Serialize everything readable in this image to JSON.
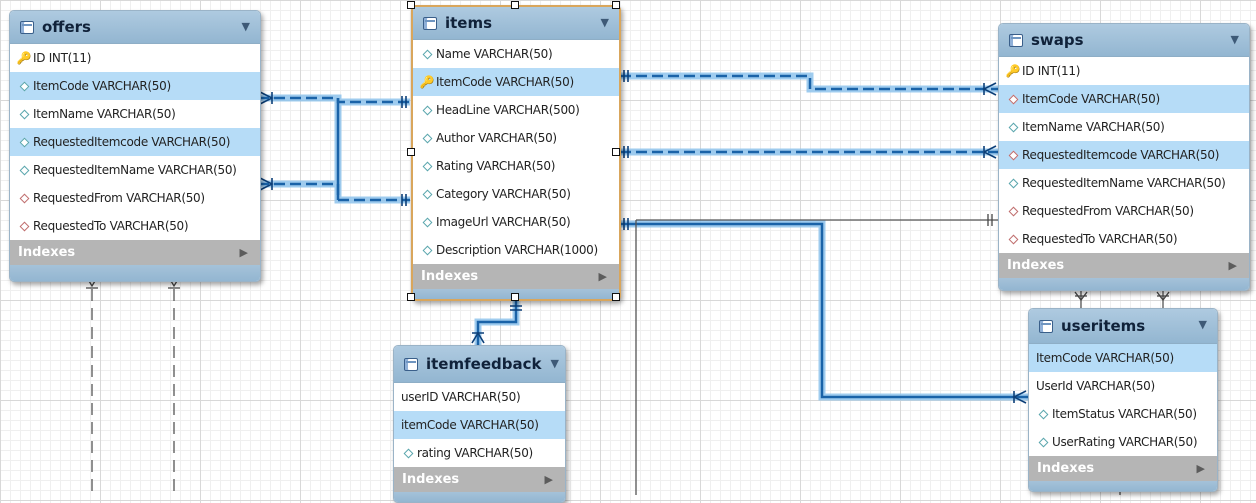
{
  "tables": {
    "offers": {
      "name": "offers",
      "fields": [
        {
          "label": "ID INT(11)",
          "icon": "key-icon"
        },
        {
          "label": "ItemCode VARCHAR(50)",
          "icon": "diamond-icon"
        },
        {
          "label": "ItemName VARCHAR(50)",
          "icon": "diamond-icon"
        },
        {
          "label": "RequestedItemcode VARCHAR(50)",
          "icon": "diamond-icon"
        },
        {
          "label": "RequestedItemName VARCHAR(50)",
          "icon": "diamond-icon"
        },
        {
          "label": "RequestedFrom VARCHAR(50)",
          "icon": "red-diamond-icon"
        },
        {
          "label": "RequestedTo VARCHAR(50)",
          "icon": "red-diamond-icon"
        }
      ],
      "indexes_label": "Indexes"
    },
    "items": {
      "name": "items",
      "fields": [
        {
          "label": "Name VARCHAR(50)",
          "icon": "diamond-icon"
        },
        {
          "label": "ItemCode VARCHAR(50)",
          "icon": "key-icon"
        },
        {
          "label": "HeadLine VARCHAR(500)",
          "icon": "diamond-icon"
        },
        {
          "label": "Author VARCHAR(50)",
          "icon": "diamond-icon"
        },
        {
          "label": "Rating VARCHAR(50)",
          "icon": "diamond-icon"
        },
        {
          "label": "Category VARCHAR(50)",
          "icon": "diamond-icon"
        },
        {
          "label": "ImageUrl VARCHAR(50)",
          "icon": "diamond-icon"
        },
        {
          "label": "Description VARCHAR(1000)",
          "icon": "diamond-icon"
        }
      ],
      "indexes_label": "Indexes"
    },
    "swaps": {
      "name": "swaps",
      "fields": [
        {
          "label": "ID INT(11)",
          "icon": "key-icon"
        },
        {
          "label": "ItemCode VARCHAR(50)",
          "icon": "red-diamond-icon"
        },
        {
          "label": "ItemName VARCHAR(50)",
          "icon": "diamond-icon"
        },
        {
          "label": "RequestedItemcode VARCHAR(50)",
          "icon": "red-diamond-icon"
        },
        {
          "label": "RequestedItemName VARCHAR(50)",
          "icon": "diamond-icon"
        },
        {
          "label": "RequestedFrom VARCHAR(50)",
          "icon": "red-diamond-icon"
        },
        {
          "label": "RequestedTo VARCHAR(50)",
          "icon": "red-diamond-icon"
        }
      ],
      "indexes_label": "Indexes"
    },
    "itemfeedback": {
      "name": "itemfeedback",
      "fields": [
        {
          "label": "userID VARCHAR(50)",
          "icon": ""
        },
        {
          "label": "itemCode VARCHAR(50)",
          "icon": ""
        },
        {
          "label": "rating VARCHAR(50)",
          "icon": "diamond-icon"
        }
      ],
      "indexes_label": "Indexes"
    },
    "useritems": {
      "name": "useritems",
      "fields": [
        {
          "label": "ItemCode VARCHAR(50)",
          "icon": ""
        },
        {
          "label": "UserId VARCHAR(50)",
          "icon": ""
        },
        {
          "label": "ItemStatus VARCHAR(50)",
          "icon": "diamond-icon"
        },
        {
          "label": "UserRating VARCHAR(50)",
          "icon": "diamond-icon"
        }
      ],
      "indexes_label": "Indexes"
    }
  },
  "colors": {
    "relation_highlight": "#1a63a8",
    "relation_glow": "#8ec3ec",
    "relation_plain": "#555555",
    "selected_border": "#d9a65c"
  }
}
